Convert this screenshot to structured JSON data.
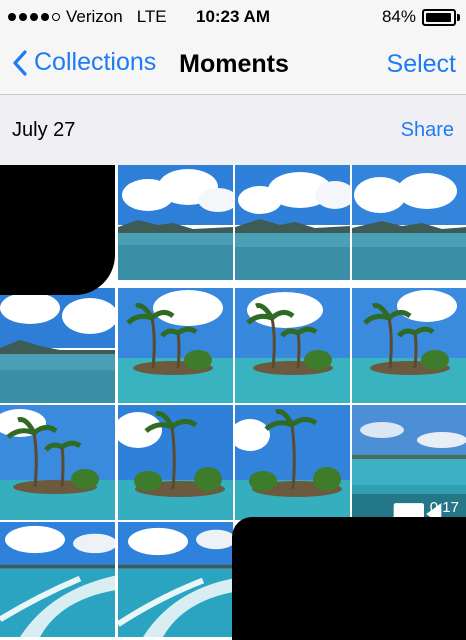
{
  "status": {
    "carrier": "Verizon",
    "network": "LTE",
    "time": "10:23 AM",
    "battery": "84%"
  },
  "nav": {
    "back_label": "Collections",
    "title": "Moments",
    "select_label": "Select"
  },
  "section": {
    "date": "July 27",
    "share_label": "Share"
  },
  "video": {
    "duration": "0:17",
    "icon": "video-camera-icon"
  },
  "colors": {
    "accent": "#1e7cf2"
  }
}
